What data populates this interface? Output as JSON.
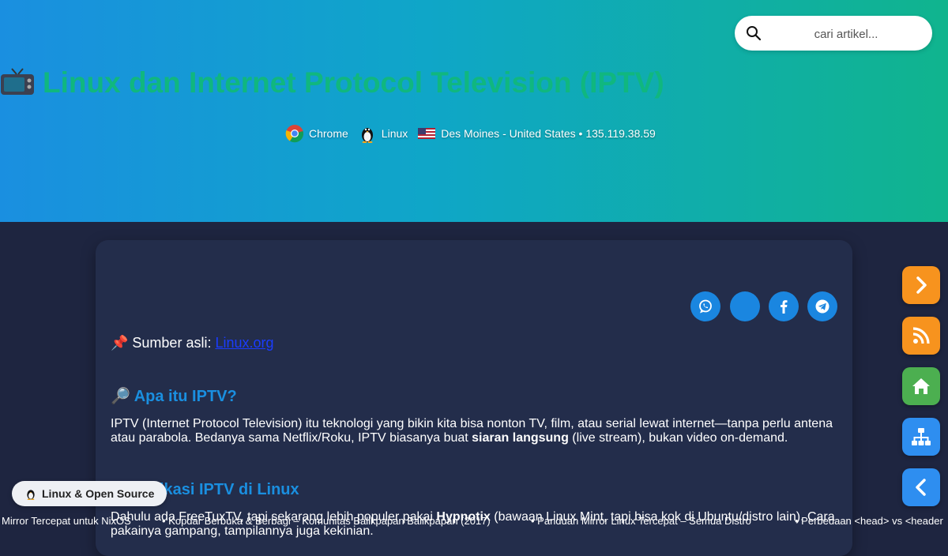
{
  "search": {
    "placeholder": "cari artikel..."
  },
  "header": {
    "title": "Linux dan Internet Protocol Television (IPTV)",
    "title_icon": "tv-icon",
    "browser": "Chrome",
    "os": "Linux",
    "location": "Des Moines - United States • 135.119.38.59"
  },
  "share": {
    "buttons": [
      "whatsapp-icon",
      "blank",
      "facebook-icon",
      "telegram-icon"
    ]
  },
  "article": {
    "source_prefix": "📌 Sumber asli: ",
    "source_link": "Linux.org",
    "section1_title": "🔎 Apa itu IPTV?",
    "section1_text_a": "IPTV (Internet Protocol Television) itu teknologi yang bikin kita bisa nonton TV, film, atau serial lewat internet—tanpa perlu antena atau parabola. Bedanya sama Netflix/Roku, IPTV biasanya buat ",
    "section1_bold": "siaran langsung",
    "section1_text_b": " (live stream), bukan video on-demand.",
    "section2_title": "📺 Aplikasi IPTV di Linux",
    "section2_text_a": "Dahulu ada FreeTuxTV, tapi sekarang lebih populer pakai ",
    "section2_bold": "Hypnotix",
    "section2_text_b": " (bawaan Linux Mint, tapi bisa kok di Ubuntu/distro lain). Cara pakainya gampang, tampilannya juga kekinian."
  },
  "side_nav": [
    "chevron-right-icon",
    "rss-icon",
    "home-icon",
    "sitemap-icon",
    "chevron-left-icon"
  ],
  "colors": {
    "hero_start": "#1a8fe0",
    "hero_end": "#10b48e",
    "title": "#10b77f",
    "accent": "#1a86e0",
    "page_bg": "#1e2540",
    "card_bg": "#232d4b",
    "side_orange": "#f7931e",
    "side_green": "#4caf50",
    "side_blue": "#2e8ef0"
  },
  "badge": {
    "label": "Linux & Open Source"
  },
  "ticker": {
    "items": [
      "Mirror Tercepat untuk NixOS",
      "• Kopdar Berbuka & Berbagi – Komunitas Balikpapan Balikpapan (2017)",
      "• Panduan Mirror Linux Tercepat – Semua Distro",
      "• Perbedaan <head> vs <header"
    ]
  }
}
